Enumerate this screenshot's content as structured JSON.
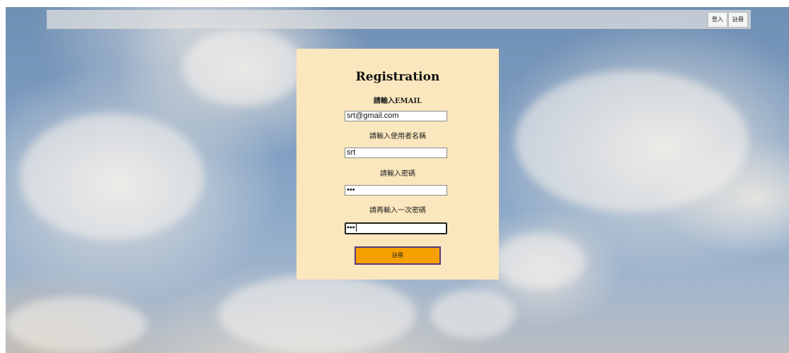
{
  "nav": {
    "login_label": "登入",
    "register_label": "註冊"
  },
  "form": {
    "title": "Registration",
    "email": {
      "label": "請輸入EMAIL",
      "value": "srt@gmail.com"
    },
    "username": {
      "label": "請輸入使用者名稱",
      "value": "srt"
    },
    "password": {
      "label": "請輸入密碼",
      "value": "•••"
    },
    "confirm_password": {
      "label": "請再輸入一次密碼",
      "value": "•••"
    },
    "submit_label": "註冊"
  },
  "colors": {
    "panel_background": "#fbe7bd",
    "submit_background": "#f5a000",
    "submit_border": "#5a3a7a"
  }
}
